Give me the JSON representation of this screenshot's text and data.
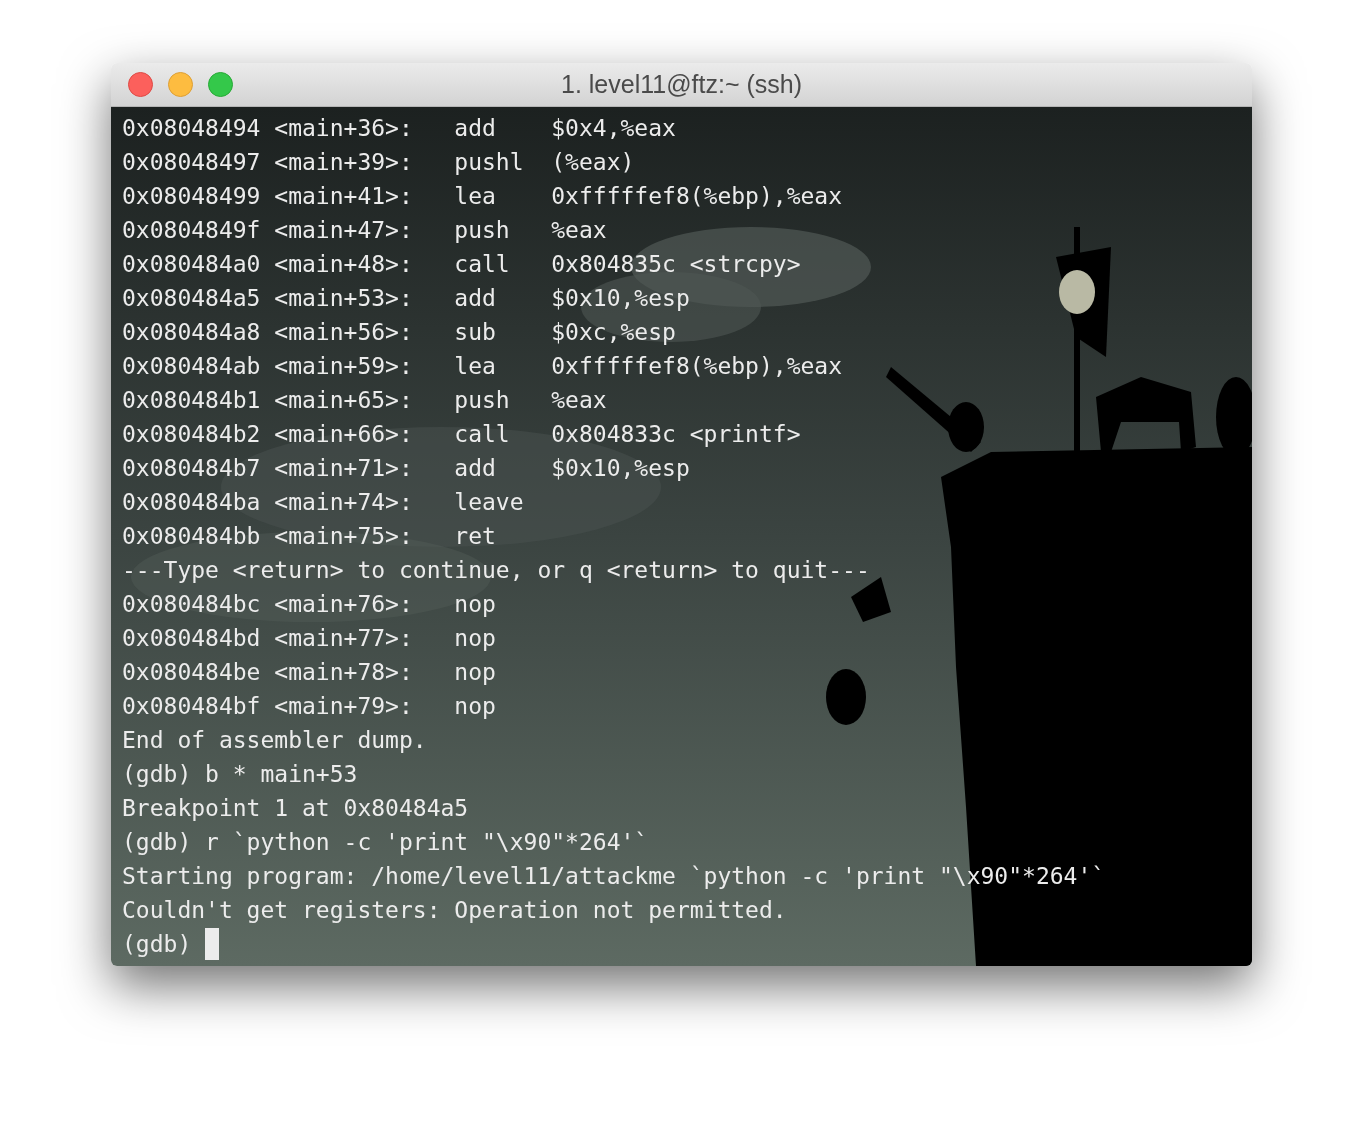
{
  "window": {
    "title": "1. level11@ftz:~ (ssh)"
  },
  "terminal": {
    "lines": [
      "0x08048494 <main+36>:   add    $0x4,%eax",
      "0x08048497 <main+39>:   pushl  (%eax)",
      "0x08048499 <main+41>:   lea    0xfffffef8(%ebp),%eax",
      "0x0804849f <main+47>:   push   %eax",
      "0x080484a0 <main+48>:   call   0x804835c <strcpy>",
      "0x080484a5 <main+53>:   add    $0x10,%esp",
      "0x080484a8 <main+56>:   sub    $0xc,%esp",
      "0x080484ab <main+59>:   lea    0xfffffef8(%ebp),%eax",
      "0x080484b1 <main+65>:   push   %eax",
      "0x080484b2 <main+66>:   call   0x804833c <printf>",
      "0x080484b7 <main+71>:   add    $0x10,%esp",
      "0x080484ba <main+74>:   leave",
      "0x080484bb <main+75>:   ret",
      "---Type <return> to continue, or q <return> to quit---",
      "0x080484bc <main+76>:   nop",
      "0x080484bd <main+77>:   nop",
      "0x080484be <main+78>:   nop",
      "0x080484bf <main+79>:   nop",
      "End of assembler dump.",
      "(gdb) b * main+53",
      "Breakpoint 1 at 0x80484a5",
      "(gdb) r `python -c 'print \"\\x90\"*264'`",
      "Starting program: /home/level11/attackme `python -c 'print \"\\x90\"*264'`",
      "Couldn't get registers: Operation not permitted.",
      "(gdb) "
    ],
    "cursor_visible": true
  }
}
